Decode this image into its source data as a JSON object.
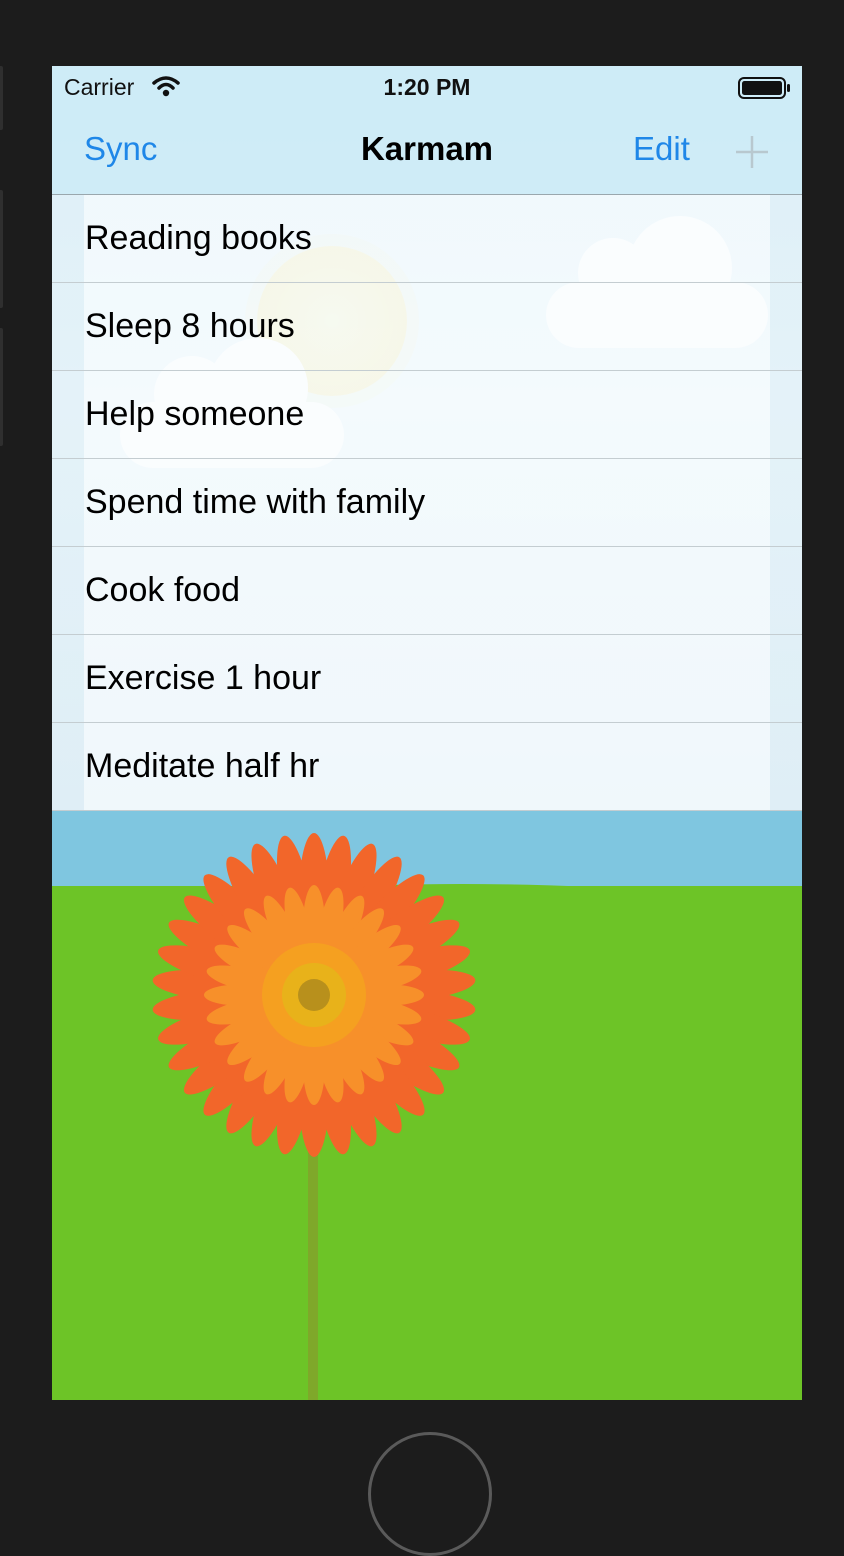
{
  "status_bar": {
    "carrier": "Carrier",
    "time": "1:20 PM",
    "wifi_icon": "wifi-icon",
    "battery_icon": "battery-icon"
  },
  "nav_bar": {
    "left_button": "Sync",
    "title": "Karmam",
    "edit_button": "Edit",
    "add_icon": "plus-icon"
  },
  "items": [
    {
      "label": "Reading books"
    },
    {
      "label": "Sleep 8 hours"
    },
    {
      "label": "Help someone"
    },
    {
      "label": "Spend time with family"
    },
    {
      "label": "Cook food"
    },
    {
      "label": "Exercise 1 hour"
    },
    {
      "label": "Meditate half hr"
    }
  ],
  "colors": {
    "accent": "#1f87e8",
    "bar_background": "#cdebf7",
    "grass": "#6dc427",
    "sky": "#7fc6e0",
    "flower_petal": "#f2662a",
    "flower_center": "#e8b21a"
  }
}
